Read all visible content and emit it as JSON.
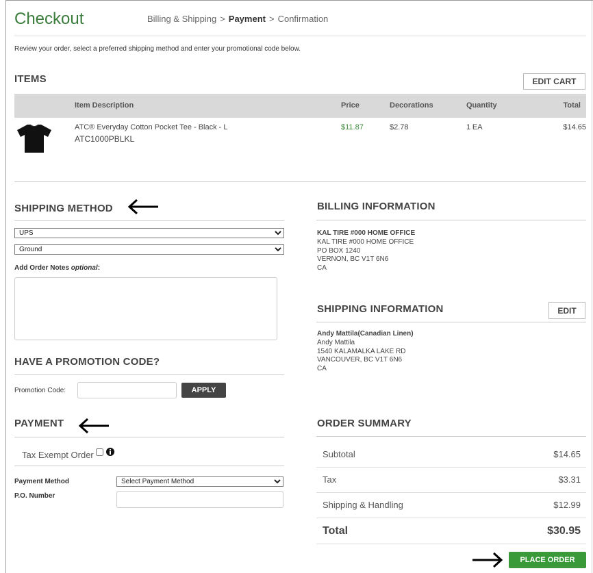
{
  "header": {
    "title": "Checkout",
    "steps": [
      "Billing & Shipping",
      "Payment",
      "Confirmation"
    ],
    "separator": ">"
  },
  "intro": "Review your order, select a preferred shipping method and enter your promotional code below.",
  "items": {
    "title": "ITEMS",
    "edit_cart": "EDIT CART",
    "columns": [
      "Item Description",
      "Price",
      "Decorations",
      "Quantity",
      "Total"
    ],
    "rows": [
      {
        "name": "ATC® Everyday Cotton Pocket Tee - Black - L",
        "sku": "ATC1000PBLKL",
        "price": "$11.87",
        "decorations": "$2.78",
        "quantity": "1",
        "unit": "EA",
        "total": "$14.65"
      }
    ]
  },
  "shipping_method": {
    "title": "SHIPPING METHOD",
    "carrier": "UPS",
    "service": "Ground",
    "notes_label": "Add Order Notes",
    "notes_optional": "optional",
    "notes_colon": ":"
  },
  "promo": {
    "title": "HAVE A PROMOTION CODE?",
    "label": "Promotion Code:",
    "apply": "APPLY"
  },
  "payment": {
    "title": "PAYMENT",
    "tax_exempt": "Tax Exempt Order",
    "method_label": "Payment Method",
    "method_value": "Select Payment Method",
    "po_label": "P.O. Number"
  },
  "billing": {
    "title": "BILLING INFORMATION",
    "lines": [
      "KAL TIRE #000 HOME OFFICE",
      "KAL TIRE #000 HOME OFFICE",
      "PO BOX 1240",
      "VERNON, BC V1T 6N6",
      "CA"
    ]
  },
  "shipping_info": {
    "title": "SHIPPING INFORMATION",
    "edit": "EDIT",
    "lines": [
      "Andy Mattila(Canadian Linen)",
      "Andy Mattila",
      "1540 KALAMALKA LAKE RD",
      "VANCOUVER, BC V1T 6N6",
      "CA"
    ]
  },
  "summary": {
    "title": "ORDER SUMMARY",
    "subtotal_label": "Subtotal",
    "subtotal": "$14.65",
    "tax_label": "Tax",
    "tax": "$3.31",
    "shipping_label": "Shipping & Handling",
    "shipping": "$12.99",
    "total_label": "Total",
    "total": "$30.95"
  },
  "place_order": "PLACE ORDER",
  "icons": {
    "annotation_arrow_left": "arrow-left-icon",
    "annotation_arrow_right": "arrow-right-icon",
    "info": "info-icon",
    "tshirt": "tshirt-icon"
  },
  "colors": {
    "brand_green": "#3a7d3a",
    "price_green": "#3a8a3a",
    "place_order": "#3a9a3a",
    "apply": "#444444"
  }
}
